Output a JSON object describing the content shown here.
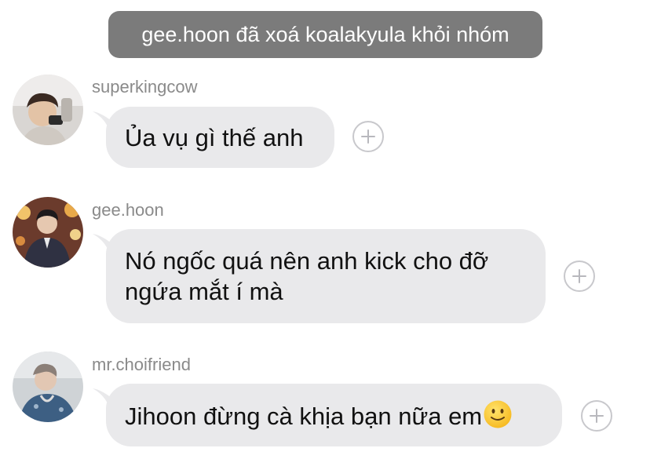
{
  "system_message": "gee.hoon đã xoá koalakyula khỏi nhóm",
  "messages": [
    {
      "username": "superkingcow",
      "text": "Ủa vụ gì thế anh",
      "avatar_icon": "avatar-photo-icon",
      "react_icon": "add-reaction-icon"
    },
    {
      "username": "gee.hoon",
      "text_lines": [
        "Nó ngốc quá nên anh kick cho đỡ",
        "ngứa mắt í mà"
      ],
      "avatar_icon": "avatar-photo-icon",
      "react_icon": "add-reaction-icon"
    },
    {
      "username": "mr.choifriend",
      "text": "Jihoon đừng cà khịa bạn nữa em",
      "emoji": "slightly-smiling-face",
      "avatar_icon": "avatar-photo-icon",
      "react_icon": "add-reaction-icon"
    }
  ],
  "colors": {
    "system_pill_bg": "#7b7b7b",
    "bubble_bg": "#e9e9eb",
    "username_text": "#8a8a8a",
    "react_border": "#c8c8cc"
  }
}
